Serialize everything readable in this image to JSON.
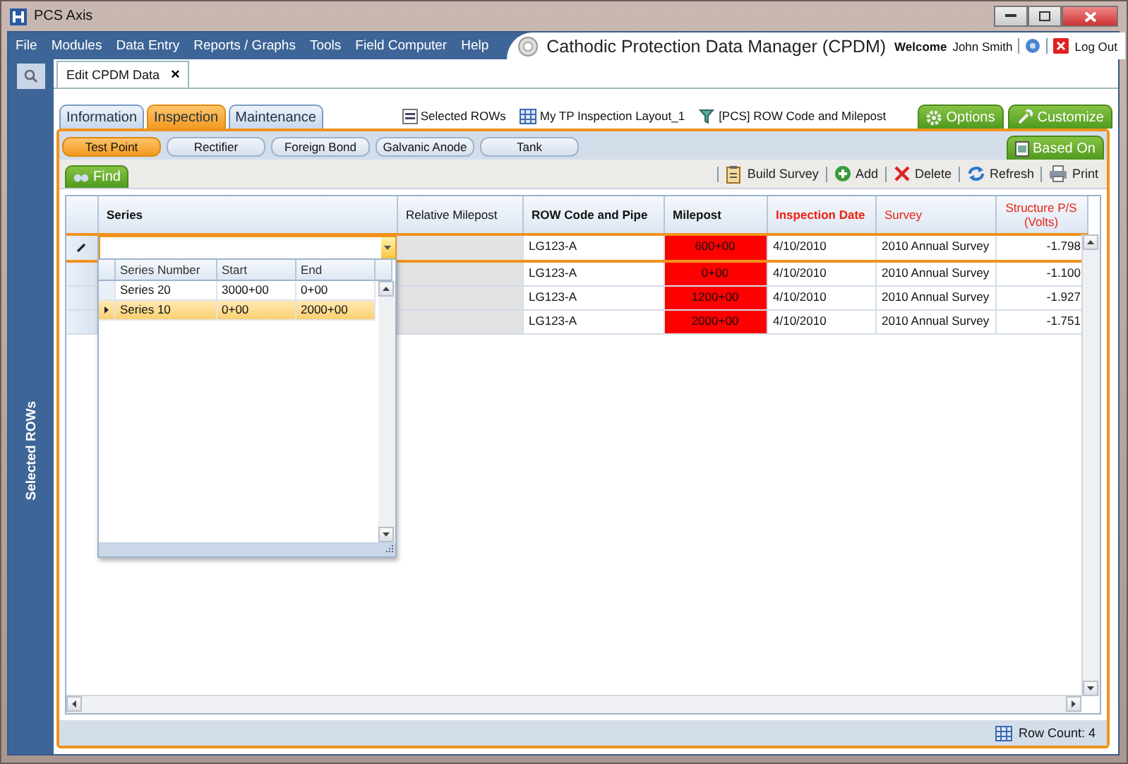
{
  "window": {
    "title": "PCS Axis"
  },
  "menu": [
    "File",
    "Modules",
    "Data Entry",
    "Reports / Graphs",
    "Tools",
    "Field Computer",
    "Help"
  ],
  "app_title": "Cathodic Protection Data Manager (CPDM)",
  "user": {
    "welcome": "Welcome",
    "name": "John Smith",
    "logout": "Log Out"
  },
  "side_panel": {
    "label": "Selected ROWs"
  },
  "document_tab": {
    "label": "Edit CPDM Data",
    "close": "×"
  },
  "tabs": [
    {
      "label": "Information",
      "selected": false
    },
    {
      "label": "Inspection",
      "selected": true
    },
    {
      "label": "Maintenance",
      "selected": false
    }
  ],
  "links": [
    {
      "kind": "rows",
      "label": "Selected ROWs"
    },
    {
      "kind": "layout",
      "label": "My TP Inspection Layout_1"
    },
    {
      "kind": "filter",
      "label": "[PCS] ROW Code and Milepost"
    }
  ],
  "top_buttons": [
    {
      "kind": "options",
      "label": "Options"
    },
    {
      "kind": "customize",
      "label": "Customize"
    }
  ],
  "sub_tabs": [
    {
      "label": "Test Point",
      "selected": true
    },
    {
      "label": "Rectifier",
      "selected": false
    },
    {
      "label": "Foreign Bond",
      "selected": false
    },
    {
      "label": "Galvanic Anode",
      "selected": false
    },
    {
      "label": "Tank",
      "selected": false
    }
  ],
  "based_on": "Based On",
  "find": "Find",
  "actions": [
    {
      "kind": "build",
      "label": "Build Survey"
    },
    {
      "kind": "add",
      "label": "Add"
    },
    {
      "kind": "delete",
      "label": "Delete"
    },
    {
      "kind": "refresh",
      "label": "Refresh"
    },
    {
      "kind": "print",
      "label": "Print"
    }
  ],
  "table": {
    "columns": [
      {
        "label": "Series",
        "bold": true,
        "required": false
      },
      {
        "label": "Relative Milepost",
        "bold": false,
        "required": false
      },
      {
        "label": "ROW Code and Pipe",
        "bold": true,
        "required": false
      },
      {
        "label": "Milepost",
        "bold": true,
        "required": false
      },
      {
        "label": "Inspection Date",
        "bold": true,
        "required": true
      },
      {
        "label": "Survey",
        "bold": false,
        "required": true
      },
      {
        "label": "Structure P/S (Volts)",
        "bold": false,
        "required": true
      }
    ],
    "rows": [
      {
        "editing": true,
        "row_code": "LG123-A",
        "milepost": "600+00",
        "flagged": true,
        "date": "4/10/2010",
        "survey": "2010 Annual Survey",
        "structure_ps": "-1.798"
      },
      {
        "editing": false,
        "row_code": "LG123-A",
        "milepost": "0+00",
        "flagged": true,
        "date": "4/10/2010",
        "survey": "2010 Annual Survey",
        "structure_ps": "-1.100"
      },
      {
        "editing": false,
        "row_code": "LG123-A",
        "milepost": "1200+00",
        "flagged": true,
        "date": "4/10/2010",
        "survey": "2010 Annual Survey",
        "structure_ps": "-1.927"
      },
      {
        "editing": false,
        "row_code": "LG123-A",
        "milepost": "2000+00",
        "flagged": true,
        "date": "4/10/2010",
        "survey": "2010 Annual Survey",
        "structure_ps": "-1.751"
      }
    ]
  },
  "series_dropdown": {
    "columns": [
      "Series Number",
      "Start",
      "End"
    ],
    "rows": [
      {
        "selected": false,
        "cells": [
          "Series 20",
          "3000+00",
          "0+00"
        ]
      },
      {
        "selected": true,
        "cells": [
          "Series 10",
          "0+00",
          "2000+00"
        ]
      }
    ]
  },
  "status": {
    "row_count": "Row Count: 4"
  }
}
